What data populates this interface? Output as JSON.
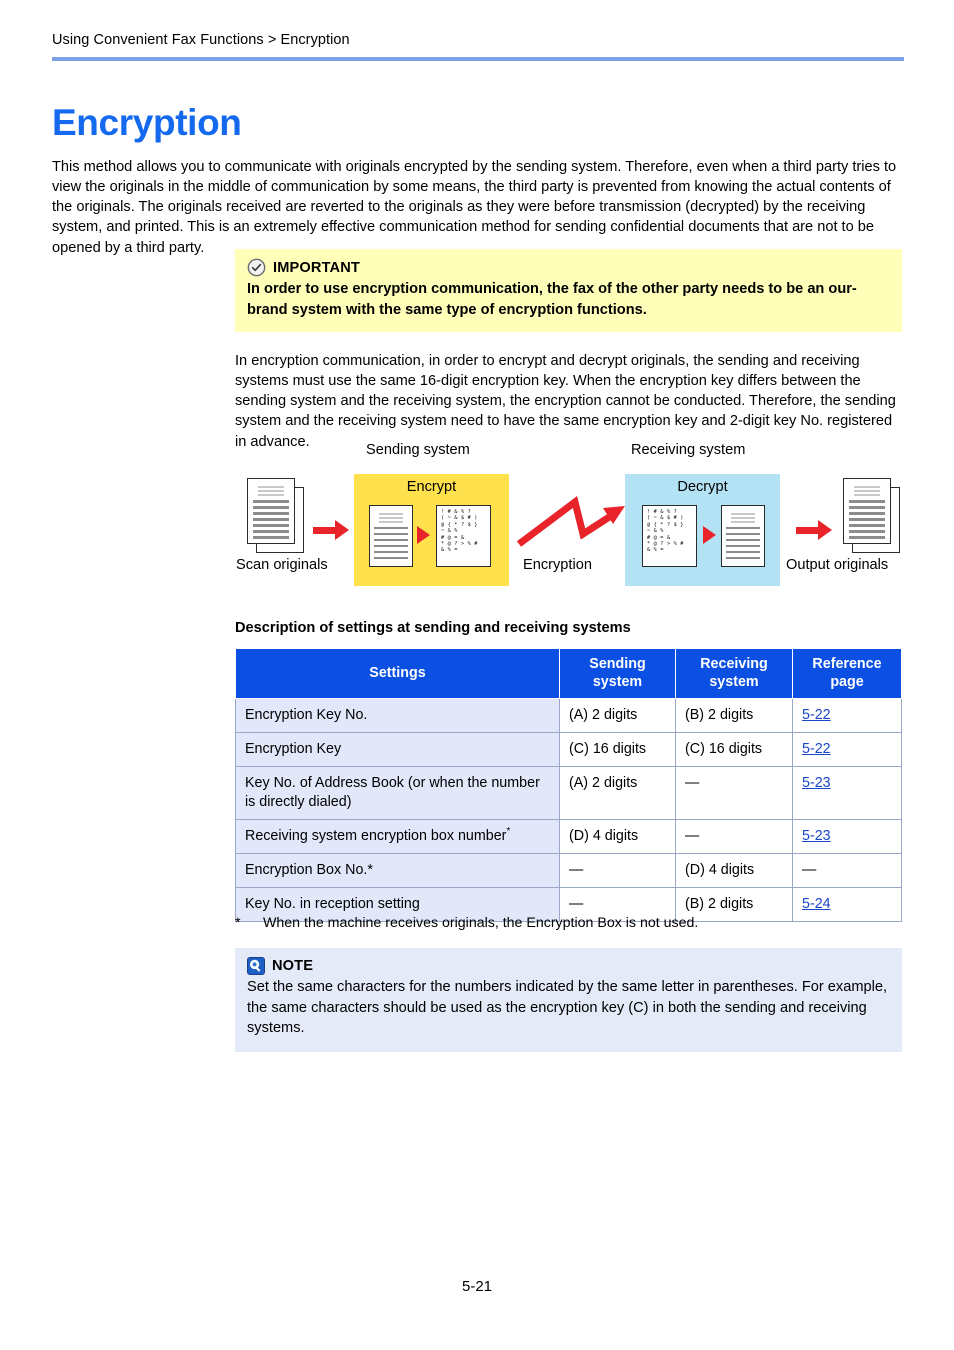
{
  "breadcrumb": "Using Convenient Fax Functions > Encryption",
  "title": "Encryption",
  "intro": "This method allows you to communicate with originals encrypted by the sending system. Therefore, even when a third party tries to view the originals in the middle of communication by some means, the third party is prevented from knowing the actual contents of the originals. The originals received are reverted to the originals as they were before transmission (decrypted) by the receiving system, and printed. This is an extremely effective communication method for sending confidential documents that are not to be opened by a third party.",
  "important": {
    "icon": "check-circle-icon",
    "label": "IMPORTANT",
    "body": "In order to use encryption communication, the fax of the other party needs to be an our-brand system with the same type of encryption functions.",
    "background": "#ffffb9"
  },
  "paragraph2": "In encryption communication, in order to encrypt and decrypt originals, the sending and receiving systems must use the same 16-digit encryption key. When the encryption key differs between the sending system and the receiving system, the encryption cannot be conducted. Therefore, the sending system and the receiving system need to have the same encryption key and 2-digit key No. registered in advance.",
  "diagram": {
    "sending_system_caption": "Sending system",
    "receiving_system_caption": "Receiving system",
    "encrypt_panel_title": "Encrypt",
    "decrypt_panel_title": "Decrypt",
    "scan_label": "Scan originals",
    "encryption_label": "Encryption",
    "output_label": "Output originals",
    "cipher_text": "! # & % ?\n( ~ & $ # )\n@ { * ? $ }\n~ & %\n# @ = &\n* @ ? > % #\n& % =",
    "encrypt_panel_color": "#ffe14d",
    "decrypt_panel_color": "#b3e2f5",
    "arrow_color": "#e8232a"
  },
  "table": {
    "caption": "Description of settings at sending and receiving systems",
    "headers": [
      "Settings",
      "Sending system",
      "Receiving system",
      "Reference page"
    ],
    "header_color": "#0b4fe3",
    "rows": [
      {
        "setting": "Encryption Key No.",
        "sending": "(A) 2 digits",
        "receiving": "(B) 2 digits",
        "reference": "5-22",
        "reference_link": true
      },
      {
        "setting": "Encryption Key",
        "sending": "(C) 16 digits",
        "receiving": "(C) 16 digits",
        "reference": "5-22",
        "reference_link": true
      },
      {
        "setting": "Key No. of Address Book (or when the number is directly dialed)",
        "sending": "(A) 2 digits",
        "receiving": "—",
        "reference": "5-23",
        "reference_link": true
      },
      {
        "setting": "Receiving system encryption box number",
        "setting_superscript": "*",
        "sending": "(D) 4 digits",
        "receiving": "—",
        "reference": "5-23",
        "reference_link": true
      },
      {
        "setting": "Encryption Box No.*",
        "sending": "—",
        "receiving": "(D) 4 digits",
        "reference": "—",
        "reference_link": false
      },
      {
        "setting": "Key No. in reception setting",
        "sending": "—",
        "receiving": "(B) 2 digits",
        "reference": "5-24",
        "reference_link": true
      }
    ]
  },
  "footnote": {
    "mark": "*",
    "text": "When the machine receives originals, the Encryption Box is not used."
  },
  "note": {
    "icon": "note-magnifier-icon",
    "label": "NOTE",
    "body": "Set the same characters for the numbers indicated by the same letter in parentheses. For example, the same characters should be used as the encryption key (C) in both the sending and receiving systems.",
    "background": "#e5eaf9"
  },
  "footer": {
    "page_number": "5-21"
  }
}
